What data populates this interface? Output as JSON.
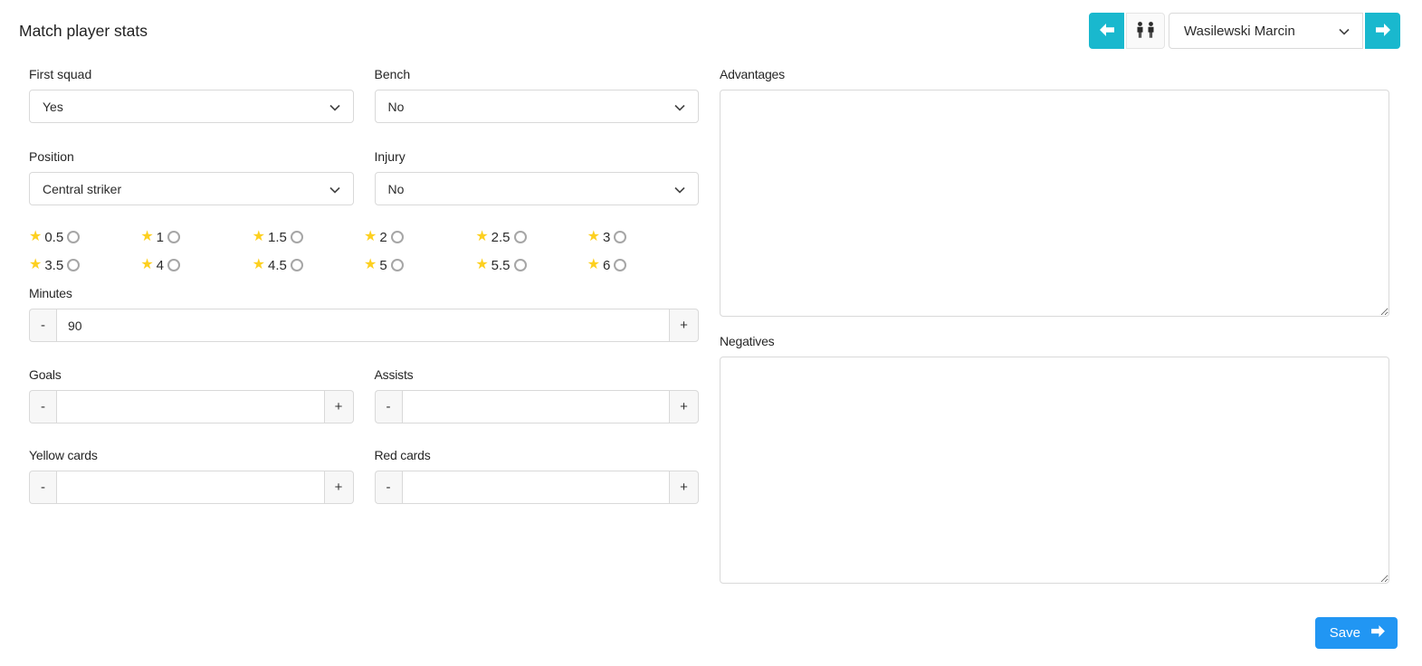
{
  "header": {
    "title": "Match player stats",
    "player_select": {
      "value": "Wasilewski Marcin"
    }
  },
  "fields": {
    "first_squad": {
      "label": "First squad",
      "value": "Yes"
    },
    "bench": {
      "label": "Bench",
      "value": "No"
    },
    "position": {
      "label": "Position",
      "value": "Central striker"
    },
    "injury": {
      "label": "Injury",
      "value": "No"
    },
    "minutes": {
      "label": "Minutes",
      "value": "90"
    },
    "goals": {
      "label": "Goals",
      "value": ""
    },
    "assists": {
      "label": "Assists",
      "value": ""
    },
    "yellow_cards": {
      "label": "Yellow cards",
      "value": ""
    },
    "red_cards": {
      "label": "Red cards",
      "value": ""
    },
    "advantages": {
      "label": "Advantages",
      "value": ""
    },
    "negatives": {
      "label": "Negatives",
      "value": ""
    }
  },
  "rating": {
    "options": [
      "0.5",
      "1",
      "1.5",
      "2",
      "2.5",
      "3",
      "3.5",
      "4",
      "4.5",
      "5",
      "5.5",
      "6"
    ],
    "selected": null,
    "star_glyph": "★"
  },
  "stepper": {
    "decrement_label": "-",
    "increment_label": "+"
  },
  "save_button": {
    "label": "Save"
  },
  "icons": {
    "prev": "arrow-left-icon",
    "players": "people-icon",
    "next": "arrow-right-icon",
    "save_arrow": "arrow-right-icon",
    "select_chevron": "chevron-down-icon"
  },
  "colors": {
    "accent_cyan": "#19b8ce",
    "save_blue": "#2196f3",
    "star_yellow": "#fdd020",
    "border": "#d9d9d9"
  }
}
